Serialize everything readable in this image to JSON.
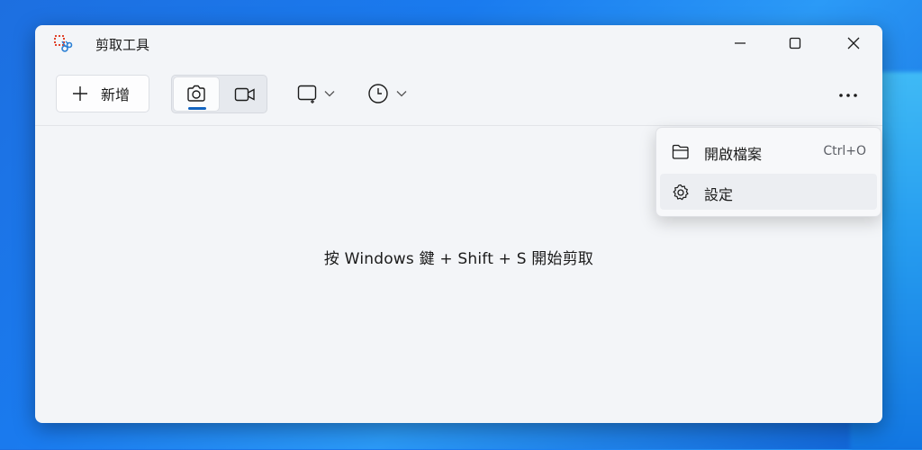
{
  "window": {
    "title": "剪取工具"
  },
  "toolbar": {
    "new_label": "新增",
    "modes": [
      {
        "name": "screenshot",
        "icon": "camera-icon",
        "selected": true
      },
      {
        "name": "video",
        "icon": "video-camera-icon",
        "selected": false
      }
    ],
    "shape_dropdown_icon": "rectangle-snip-icon",
    "delay_dropdown_icon": "clock-icon",
    "more_icon": "more-options-icon"
  },
  "main": {
    "hint": "按 Windows 鍵 + Shift + S 開始剪取"
  },
  "menu": {
    "items": [
      {
        "label": "開啟檔案",
        "shortcut": "Ctrl+O",
        "icon": "folder-open-icon"
      },
      {
        "label": "設定",
        "shortcut": "",
        "icon": "gear-icon"
      }
    ]
  },
  "colors": {
    "accent": "#1364c0",
    "window_bg": "#f3f5f8",
    "desktop": "#1a7bef"
  }
}
